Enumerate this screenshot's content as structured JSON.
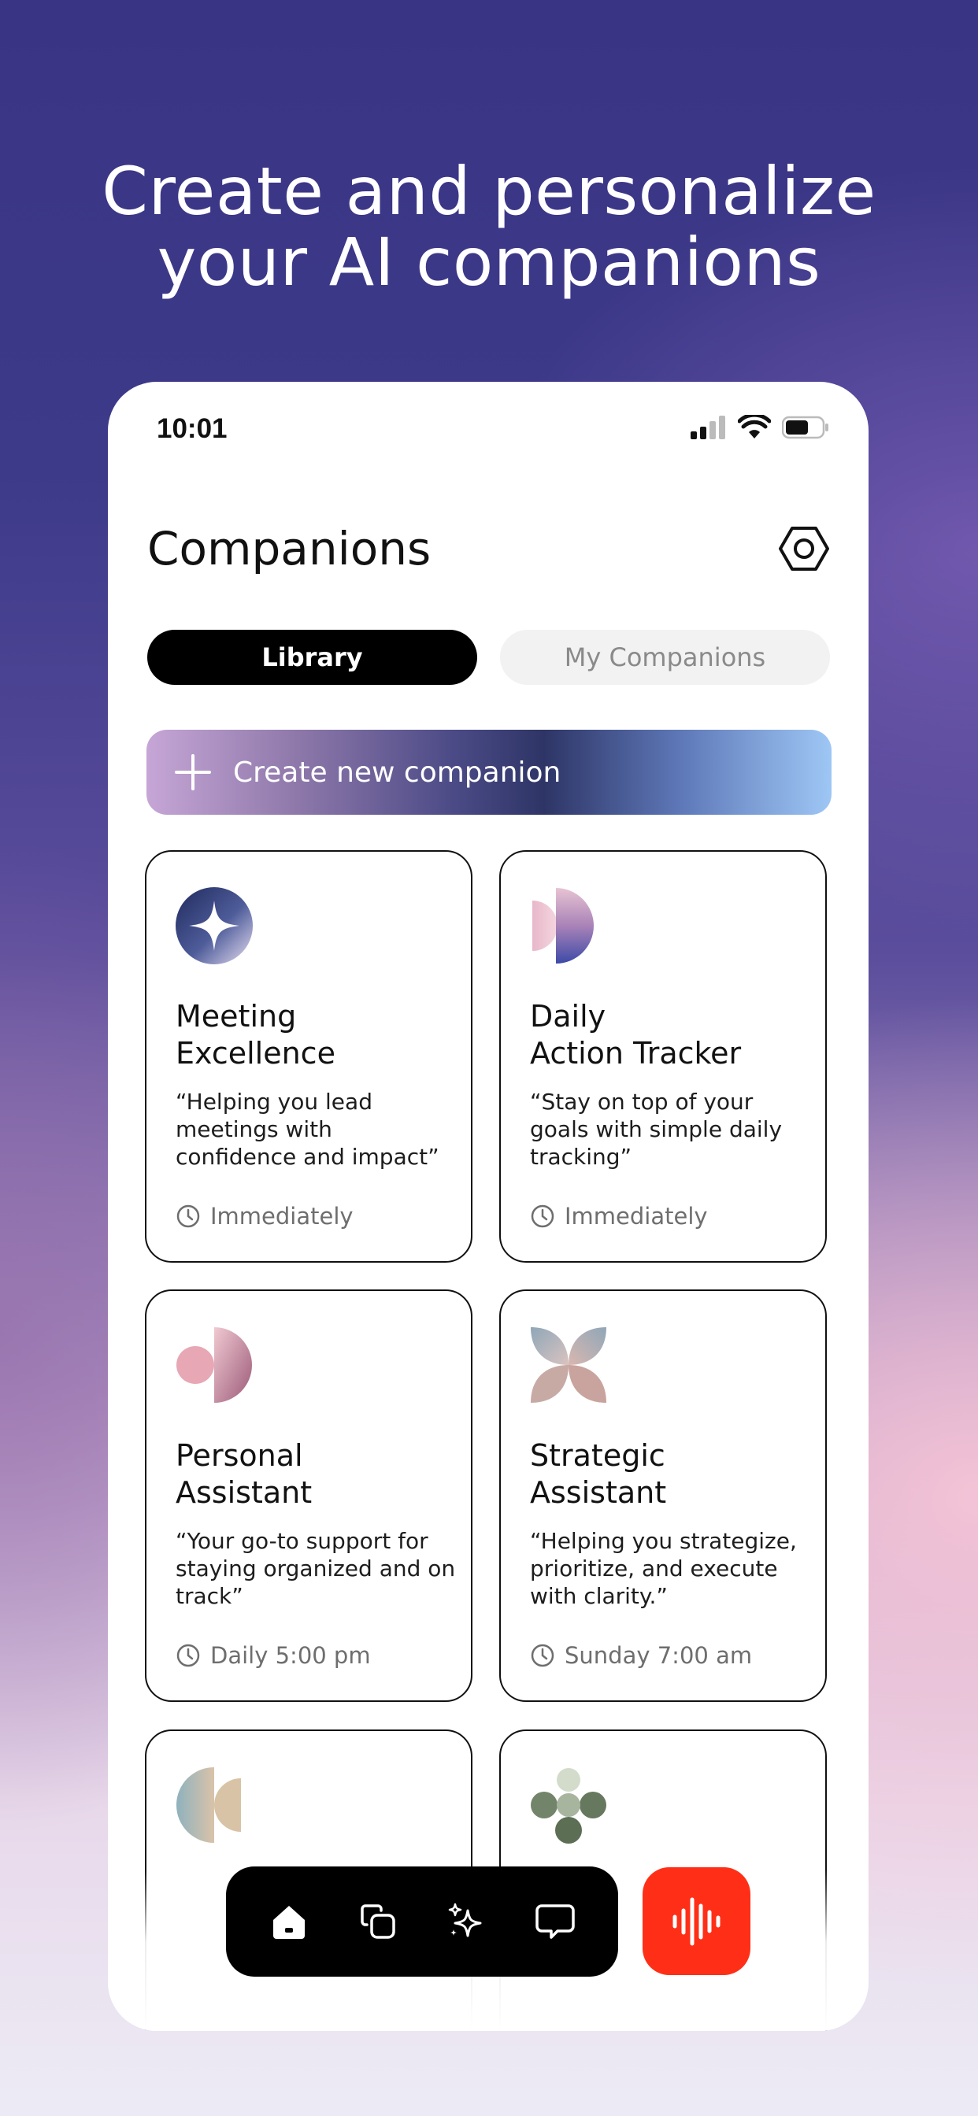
{
  "headline": {
    "line1": "Create and personalize",
    "line2": "your AI companions"
  },
  "status_bar": {
    "time": "10:01"
  },
  "header": {
    "title": "Companions"
  },
  "segments": {
    "active": "Library",
    "inactive": "My Companions"
  },
  "create_button": {
    "label": "Create new companion"
  },
  "cards": [
    {
      "name1": "Meeting",
      "name2": "Excellence",
      "description": "“Helping you lead meetings with confidence and impact”",
      "schedule": "Immediately"
    },
    {
      "name1": "Daily",
      "name2": "Action Tracker",
      "description": "“Stay on top of your goals with simple daily tracking”",
      "schedule": "Immediately"
    },
    {
      "name1": "Personal",
      "name2": "Assistant",
      "description": "“Your go-to support for staying organized and on track”",
      "schedule": "Daily 5:00 pm"
    },
    {
      "name1": "Strategic",
      "name2": "Assistant",
      "description": "“Helping you strategize, prioritize, and execute with clarity.”",
      "schedule": "Sunday 7:00 am"
    }
  ],
  "nav": [
    "home-icon",
    "copy-icon",
    "sparkles-icon",
    "chat-icon"
  ],
  "colors": {
    "accent_voice": "#ff2f17",
    "active_segment": "#000000"
  }
}
